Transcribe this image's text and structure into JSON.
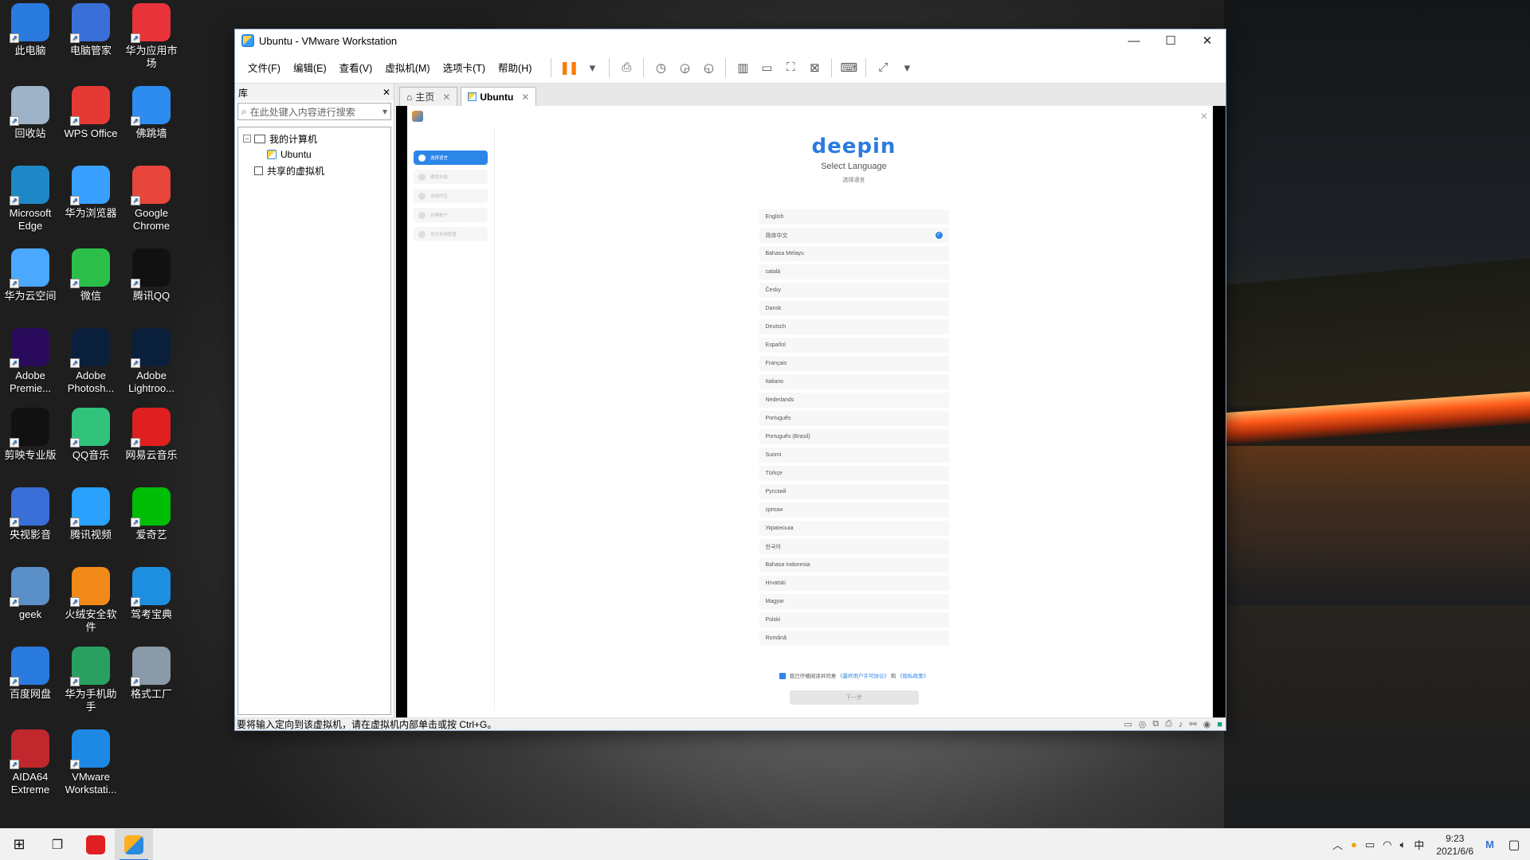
{
  "desktop": {
    "icons": [
      {
        "label": "此电脑",
        "icon": "computer-icon",
        "color": "#2a7bdf"
      },
      {
        "label": "电脑管家",
        "icon": "pc-manager-icon",
        "color": "#3b6fd8"
      },
      {
        "label": "华为应用市场",
        "icon": "huawei-appgallery-icon",
        "color": "#e8333a"
      },
      {
        "label": "回收站",
        "icon": "recycle-bin-icon",
        "color": "#9fb3c8"
      },
      {
        "label": "WPS Office",
        "icon": "wps-icon",
        "color": "#e53935"
      },
      {
        "label": "佛跳墙",
        "icon": "fotiaoqiang-icon",
        "color": "#2d8cf0"
      },
      {
        "label": "Microsoft Edge",
        "icon": "edge-icon",
        "color": "#1e88c7"
      },
      {
        "label": "华为浏览器",
        "icon": "huawei-browser-icon",
        "color": "#3aa0ff"
      },
      {
        "label": "Google Chrome",
        "icon": "chrome-icon",
        "color": "#e8453c"
      },
      {
        "label": "华为云空间",
        "icon": "huawei-cloud-icon",
        "color": "#4aa8ff"
      },
      {
        "label": "微信",
        "icon": "wechat-icon",
        "color": "#2bbf4a"
      },
      {
        "label": "腾讯QQ",
        "icon": "qq-icon",
        "color": "#111111"
      },
      {
        "label": "Adobe Premie...",
        "icon": "premiere-icon",
        "color": "#2a0a5a"
      },
      {
        "label": "Adobe Photosh...",
        "icon": "photoshop-icon",
        "color": "#0a1f3c"
      },
      {
        "label": "Adobe Lightroo...",
        "icon": "lightroom-icon",
        "color": "#0a1f3c"
      },
      {
        "label": "剪映专业版",
        "icon": "jianying-icon",
        "color": "#111111"
      },
      {
        "label": "QQ音乐",
        "icon": "qqmusic-icon",
        "color": "#31c27c"
      },
      {
        "label": "网易云音乐",
        "icon": "netease-music-icon",
        "color": "#e02020"
      },
      {
        "label": "央视影音",
        "icon": "cctv-icon",
        "color": "#3a6fd8"
      },
      {
        "label": "腾讯视频",
        "icon": "tencent-video-icon",
        "color": "#2aa0ff"
      },
      {
        "label": "爱奇艺",
        "icon": "iqiyi-icon",
        "color": "#00be06"
      },
      {
        "label": "geek",
        "icon": "geek-icon",
        "color": "#5a8fc8"
      },
      {
        "label": "火绒安全软件",
        "icon": "huorong-icon",
        "color": "#f28a1a"
      },
      {
        "label": "驾考宝典",
        "icon": "jiakao-icon",
        "color": "#1e8fe0"
      },
      {
        "label": "百度网盘",
        "icon": "baidu-netdisk-icon",
        "color": "#2a7bdf"
      },
      {
        "label": "华为手机助手",
        "icon": "huawei-hisuite-icon",
        "color": "#2aa060"
      },
      {
        "label": "格式工厂",
        "icon": "format-factory-icon",
        "color": "#8a9aa8"
      },
      {
        "label": "AIDA64 Extreme",
        "icon": "aida64-icon",
        "color": "#c0282d"
      },
      {
        "label": "VMware Workstati...",
        "icon": "vmware-icon",
        "color": "#1e88e5"
      }
    ]
  },
  "vmware": {
    "title": "Ubuntu - VMware Workstation",
    "window_buttons": {
      "minimize": "—",
      "maximize": "☐",
      "close": "✕"
    },
    "menu": [
      "文件(F)",
      "编辑(E)",
      "查看(V)",
      "虚拟机(M)",
      "选项卡(T)",
      "帮助(H)"
    ],
    "library": {
      "title": "库",
      "close": "✕",
      "search_placeholder": "在此处键入内容进行搜索",
      "tree": {
        "my_computer": "我的计算机",
        "vm": "Ubuntu",
        "shared": "共享的虚拟机"
      }
    },
    "tabs": [
      {
        "label": "主页",
        "active": false
      },
      {
        "label": "Ubuntu",
        "active": true
      }
    ],
    "status_text": "要将输入定向到该虚拟机，请在虚拟机内部单击或按 Ctrl+G。"
  },
  "installer": {
    "brand": "deepin",
    "title": "Select Language",
    "subtitle": "选择语言",
    "steps": [
      "选择语言",
      "硬盘布局",
      "选择时区",
      "创建账户",
      "优化系统配置"
    ],
    "languages": [
      {
        "name": "English",
        "selected": false
      },
      {
        "name": "简体中文",
        "selected": true
      },
      {
        "name": "Bahasa Melayu",
        "selected": false
      },
      {
        "name": "català",
        "selected": false
      },
      {
        "name": "Česky",
        "selected": false
      },
      {
        "name": "Dansk",
        "selected": false
      },
      {
        "name": "Deutsch",
        "selected": false
      },
      {
        "name": "Español",
        "selected": false
      },
      {
        "name": "Français",
        "selected": false
      },
      {
        "name": "Italiano",
        "selected": false
      },
      {
        "name": "Nederlands",
        "selected": false
      },
      {
        "name": "Português",
        "selected": false
      },
      {
        "name": "Português (Brasil)",
        "selected": false
      },
      {
        "name": "Suomi",
        "selected": false
      },
      {
        "name": "Türkçe",
        "selected": false
      },
      {
        "name": "Русский",
        "selected": false
      },
      {
        "name": "српски",
        "selected": false
      },
      {
        "name": "Українська",
        "selected": false
      },
      {
        "name": "한국어",
        "selected": false
      },
      {
        "name": "Bahasa Indonesia",
        "selected": false
      },
      {
        "name": "Hrvatski",
        "selected": false
      },
      {
        "name": "Magyar",
        "selected": false
      },
      {
        "name": "Polski",
        "selected": false
      },
      {
        "name": "Română",
        "selected": false
      }
    ],
    "agree_text": "我已仔细阅读并同意",
    "agree_link1": "《最终用户许可协议》",
    "agree_and": "和",
    "agree_link2": "《隐私政策》",
    "next_label": "下一步",
    "accent_color": "#2c86e8"
  },
  "taskbar": {
    "time": "9:23",
    "date": "2021/6/6",
    "ime": "中"
  }
}
